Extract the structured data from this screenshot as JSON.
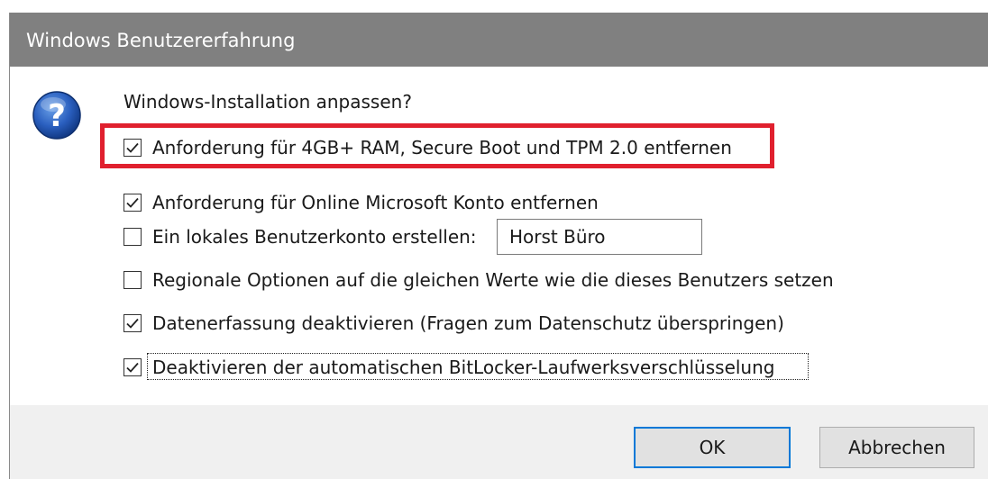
{
  "dialog": {
    "title": "Windows Benutzererfahrung",
    "prompt": "Windows-Installation anpassen?",
    "icon": "question-icon",
    "options": [
      {
        "label": "Anforderung für 4GB+ RAM, Secure Boot und TPM 2.0 entfernen",
        "checked": true
      },
      {
        "label": "Anforderung für Online Microsoft Konto entfernen",
        "checked": true
      },
      {
        "label": "Ein lokales Benutzerkonto erstellen:",
        "checked": false
      },
      {
        "label": "Regionale Optionen auf die gleichen Werte wie die dieses Benutzers setzen",
        "checked": false
      },
      {
        "label": "Datenerfassung deaktivieren (Fragen zum Datenschutz überspringen)",
        "checked": true
      },
      {
        "label": "Deaktivieren der automatischen BitLocker-Laufwerksverschlüsselung",
        "checked": true
      }
    ],
    "username_value": "Horst Büro",
    "ok_label": "OK",
    "cancel_label": "Abbrechen",
    "highlight_color": "#e0202e",
    "accent": "#0078d7"
  }
}
